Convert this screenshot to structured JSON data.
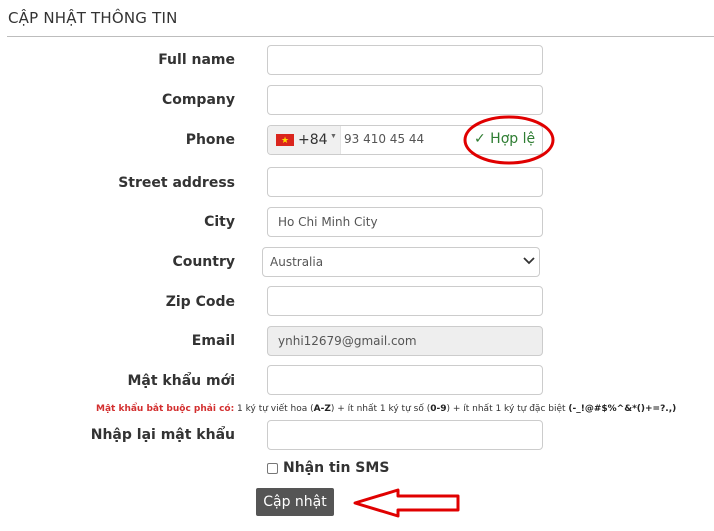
{
  "page": {
    "title": "CẬP NHẬT THÔNG TIN"
  },
  "form": {
    "full_name": {
      "label": "Full name",
      "value": ""
    },
    "company": {
      "label": "Company",
      "value": ""
    },
    "phone": {
      "label": "Phone",
      "country_flag": "vietnam-flag",
      "dial_code": "+84",
      "value": "93 410 45 44",
      "validation": "✓ Hợp lệ"
    },
    "street_address": {
      "label": "Street address",
      "value": ""
    },
    "city": {
      "label": "City",
      "value": "Ho Chi Minh City"
    },
    "country": {
      "label": "Country",
      "selected": "Australia"
    },
    "zip_code": {
      "label": "Zip Code",
      "value": ""
    },
    "email": {
      "label": "Email",
      "value": "ynhi12679@gmail.com"
    },
    "new_password": {
      "label": "Mật khẩu mới",
      "value": ""
    },
    "password_rule": {
      "prefix": "Mật khẩu bắt buộc phải có:",
      "p1": " 1 ký tự viết hoa (",
      "b1": "A-Z",
      "p2": ") + ít nhất 1 ký tự số (",
      "b2": "0-9",
      "p3": ") + ít nhất 1 ký tự đặc biệt ",
      "b3": "(-_!@#$%^&*()+=?.,)"
    },
    "confirm_password": {
      "label": "Nhập lại mật khẩu",
      "value": ""
    },
    "sms_optin": {
      "label": "Nhận tin SMS",
      "checked": false
    },
    "submit_label": "Cập nhật"
  },
  "annotations": {
    "highlight_color": "#e00000"
  }
}
